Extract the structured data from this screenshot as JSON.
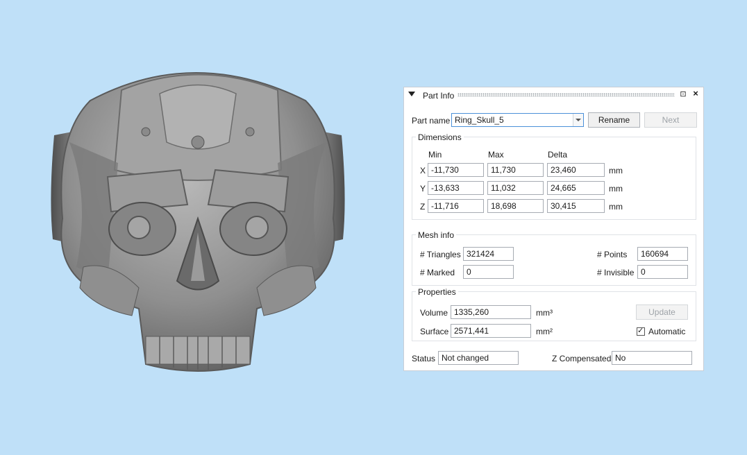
{
  "panel": {
    "title": "Part Info",
    "pin_symbol": "⊡",
    "close_symbol": "×",
    "part_name_label": "Part name",
    "part_name_value": "Ring_Skull_5",
    "rename_label": "Rename",
    "next_label": "Next",
    "dimensions": {
      "title": "Dimensions",
      "headers": [
        "Min",
        "Max",
        "Delta"
      ],
      "rows": [
        {
          "axis": "X",
          "min": "-11,730",
          "max": "11,730",
          "delta": "23,460",
          "unit": "mm"
        },
        {
          "axis": "Y",
          "min": "-13,633",
          "max": "11,032",
          "delta": "24,665",
          "unit": "mm"
        },
        {
          "axis": "Z",
          "min": "-11,716",
          "max": "18,698",
          "delta": "30,415",
          "unit": "mm"
        }
      ]
    },
    "mesh_info": {
      "title": "Mesh info",
      "triangles_label": "# Triangles",
      "triangles_value": "321424",
      "points_label": "# Points",
      "points_value": "160694",
      "marked_label": "# Marked",
      "marked_value": "0",
      "invisible_label": "# Invisible",
      "invisible_value": "0"
    },
    "properties": {
      "title": "Properties",
      "volume_label": "Volume",
      "volume_value": "1335,260",
      "volume_unit": "mm³",
      "surface_label": "Surface",
      "surface_value": "2571,441",
      "surface_unit": "mm²",
      "update_label": "Update",
      "automatic_label": "Automatic",
      "automatic_checked": true
    },
    "status_label": "Status",
    "status_value": "Not changed",
    "zcomp_label": "Z Compensated",
    "zcomp_value": "No"
  },
  "colors": {
    "viewport_bg": "#bfe0f8",
    "model_gray": "#8c8c8c"
  }
}
